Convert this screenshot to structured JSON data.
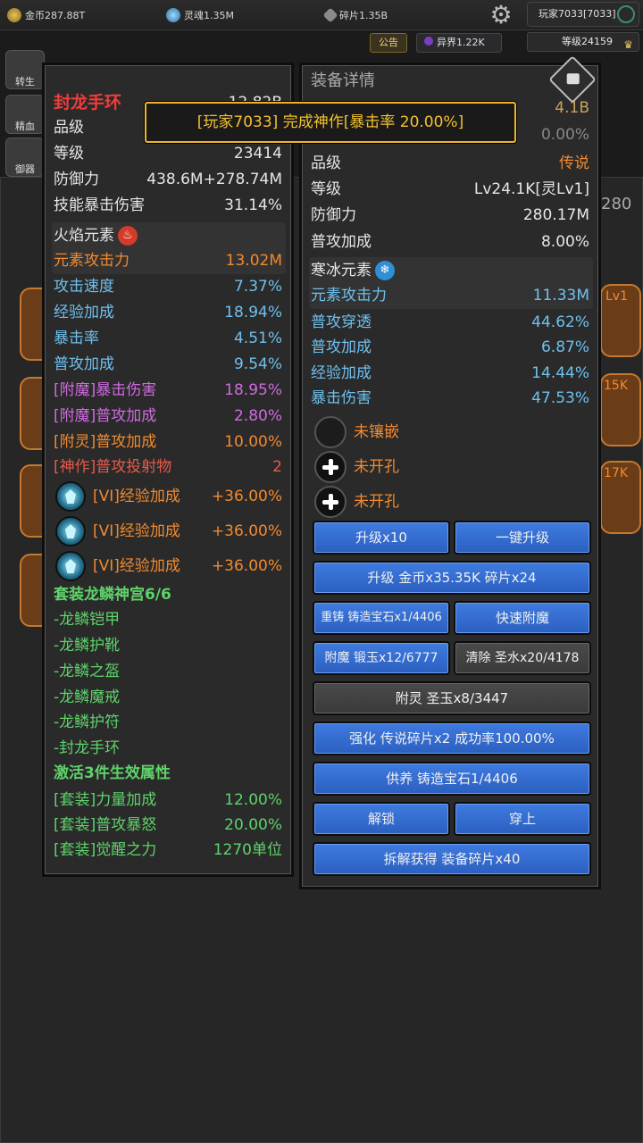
{
  "topbar": {
    "gold": "金币287.88T",
    "soul": "灵魂1.35M",
    "shards": "碎片1.35B",
    "player": "玩家7033[7033]",
    "notice": "公告",
    "otherworld": "异界1.22K",
    "level": "等级24159"
  },
  "side": {
    "rebirth": "转生",
    "refine": "精血",
    "defend": "御器"
  },
  "bg": {
    "num_280": "280",
    "lv1": "Lv1",
    "v15k": "15K",
    "v17k": "17K",
    "gold_41b": "4.1B",
    "rate_0": "0.00%"
  },
  "banner": {
    "text": "[玩家7033] 完成神作[暴击率 20.00%]"
  },
  "left": {
    "name": "封龙手环",
    "name_value": "12.82B",
    "quality_label": "品级",
    "level_label": "等级",
    "level_value": "23414",
    "defense_label": "防御力",
    "defense_value": "438.6M+278.74M",
    "skill_crit_label": "技能暴击伤害",
    "skill_crit_value": "31.14%",
    "element_title": "火焰元素",
    "element_icon": "fire-icon",
    "elem_atk_label": "元素攻击力",
    "elem_atk_value": "13.02M",
    "stats": [
      {
        "label": "攻击速度",
        "value": "7.37%"
      },
      {
        "label": "经验加成",
        "value": "18.94%"
      },
      {
        "label": "暴击率",
        "value": "4.51%"
      },
      {
        "label": "普攻加成",
        "value": "9.54%"
      }
    ],
    "enchant": [
      {
        "label": "[附魔]暴击伤害",
        "value": "18.95%"
      },
      {
        "label": "[附魔]普攻加成",
        "value": "2.80%"
      }
    ],
    "spirit": {
      "label": "[附灵]普攻加成",
      "value": "10.00%"
    },
    "divine": {
      "label": "[神作]普攻投射物",
      "value": "2"
    },
    "gems": [
      {
        "label": "[VI]经验加成",
        "value": "+36.00%"
      },
      {
        "label": "[VI]经验加成",
        "value": "+36.00%"
      },
      {
        "label": "[VI]经验加成",
        "value": "+36.00%"
      }
    ],
    "set_title": "套装龙鳞神宫6/6",
    "set_items": [
      "-龙鳞铠甲",
      "-龙鳞护靴",
      "-龙鳞之盔",
      "-龙鳞魔戒",
      "-龙鳞护符",
      "-封龙手环"
    ],
    "set_effect_title": "激活3件生效属性",
    "set_effects": [
      {
        "label": "[套装]力量加成",
        "value": "12.00%"
      },
      {
        "label": "[套装]普攻暴怒",
        "value": "20.00%"
      },
      {
        "label": "[套装]觉醒之力",
        "value": "1270单位"
      }
    ]
  },
  "right": {
    "header": "装备详情",
    "quality_label": "品级",
    "quality_value": "传说",
    "level_label": "等级",
    "level_value": "Lv24.1K[灵Lv1]",
    "defense_label": "防御力",
    "defense_value": "280.17M",
    "normal_bonus_label": "普攻加成",
    "normal_bonus_value": "8.00%",
    "element_title": "寒冰元素",
    "element_icon": "snowflake-icon",
    "elem_atk_label": "元素攻击力",
    "elem_atk_value": "11.33M",
    "stats": [
      {
        "label": "普攻穿透",
        "value": "44.62%"
      },
      {
        "label": "普攻加成",
        "value": "6.87%"
      },
      {
        "label": "经验加成",
        "value": "14.44%"
      },
      {
        "label": "暴击伤害",
        "value": "47.53%"
      }
    ],
    "socket_empty": "未镶嵌",
    "socket_closed_1": "未开孔",
    "socket_closed_2": "未开孔",
    "buttons": {
      "upgrade_x10": "升级x10",
      "one_key_upgrade": "一键升级",
      "upgrade_cost": "升级 金币x35.35K 碎片x24",
      "recast": "重铸 铸造宝石x1/4406",
      "quick_enchant": "快速附魔",
      "enchant": "附魔 锻玉x12/6777",
      "clear": "清除 圣水x20/4178",
      "spirit": "附灵 圣玉x8/3447",
      "strengthen": "强化 传说碎片x2 成功率100.00%",
      "nurture": "供养 铸造宝石1/4406",
      "unlock": "解锁",
      "equip": "穿上",
      "dismantle": "拆解获得 装备碎片x40"
    }
  },
  "colors": {
    "button_blue": "#3f7be0",
    "banner_gold": "#f0b429",
    "stat_blue": "#6fc0ee",
    "legend_orange": "#f28a2e",
    "set_green": "#5ed36a",
    "enchant_purple": "#d06be0",
    "title_red": "#f03c3c"
  }
}
